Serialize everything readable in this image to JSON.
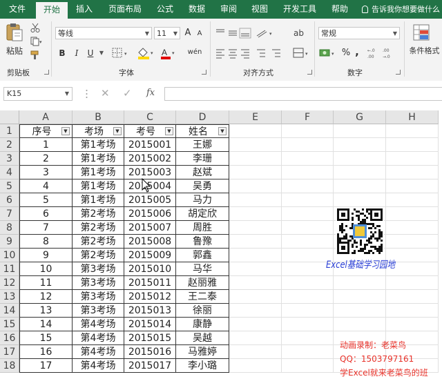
{
  "tabs": [
    "文件",
    "开始",
    "插入",
    "页面布局",
    "公式",
    "数据",
    "审阅",
    "视图",
    "开发工具",
    "帮助"
  ],
  "tell_me": "告诉我你想要做什么",
  "ribbon": {
    "clipboard": {
      "paste": "粘贴",
      "label": "剪贴板"
    },
    "font": {
      "name": "等线",
      "size": "11",
      "grow": "A",
      "shrink": "A",
      "bold": "B",
      "italic": "I",
      "underline": "U",
      "phonetic": "wén",
      "label": "字体"
    },
    "alignment": {
      "label": "对齐方式"
    },
    "number": {
      "format": "常规",
      "percent": "%",
      "comma": ",",
      "label": "数字"
    },
    "styles": {
      "conditional": "条件格式"
    }
  },
  "formula_bar": {
    "name_box": "K15",
    "fx": "fx",
    "value": ""
  },
  "columns": [
    "A",
    "B",
    "C",
    "D",
    "E",
    "F",
    "G",
    "H"
  ],
  "rows": [
    "1",
    "2",
    "3",
    "4",
    "5",
    "6",
    "7",
    "8",
    "9",
    "10",
    "11",
    "12",
    "13",
    "14",
    "15",
    "16",
    "17",
    "18"
  ],
  "table": {
    "headers": [
      "序号",
      "考场",
      "考号",
      "姓名"
    ],
    "data": [
      [
        "1",
        "第1考场",
        "2015001",
        "王娜"
      ],
      [
        "2",
        "第1考场",
        "2015002",
        "李珊"
      ],
      [
        "3",
        "第1考场",
        "2015003",
        "赵斌"
      ],
      [
        "4",
        "第1考场",
        "2015004",
        "吴勇"
      ],
      [
        "5",
        "第1考场",
        "2015005",
        "马力"
      ],
      [
        "6",
        "第2考场",
        "2015006",
        "胡定欣"
      ],
      [
        "7",
        "第2考场",
        "2015007",
        "周胜"
      ],
      [
        "8",
        "第2考场",
        "2015008",
        "鲁豫"
      ],
      [
        "9",
        "第2考场",
        "2015009",
        "郭鑫"
      ],
      [
        "10",
        "第3考场",
        "2015010",
        "马华"
      ],
      [
        "11",
        "第3考场",
        "2015011",
        "赵丽雅"
      ],
      [
        "12",
        "第3考场",
        "2015012",
        "王二泰"
      ],
      [
        "13",
        "第3考场",
        "2015013",
        "徐丽"
      ],
      [
        "14",
        "第4考场",
        "2015014",
        "康静"
      ],
      [
        "15",
        "第4考场",
        "2015015",
        "吴越"
      ],
      [
        "16",
        "第4考场",
        "2015016",
        "马雅婷"
      ],
      [
        "17",
        "第4考场",
        "2015017",
        "李小璐"
      ]
    ]
  },
  "watermark": {
    "logo_text": "Excel基础学习园地"
  },
  "credits": [
    "动画录制：老菜鸟",
    "QQ：1503797161",
    "学Excel就来老菜鸟的班"
  ],
  "colors": {
    "excel_green": "#217346",
    "credit_red": "#e8322a",
    "logo_blue": "#2a3fd6"
  }
}
